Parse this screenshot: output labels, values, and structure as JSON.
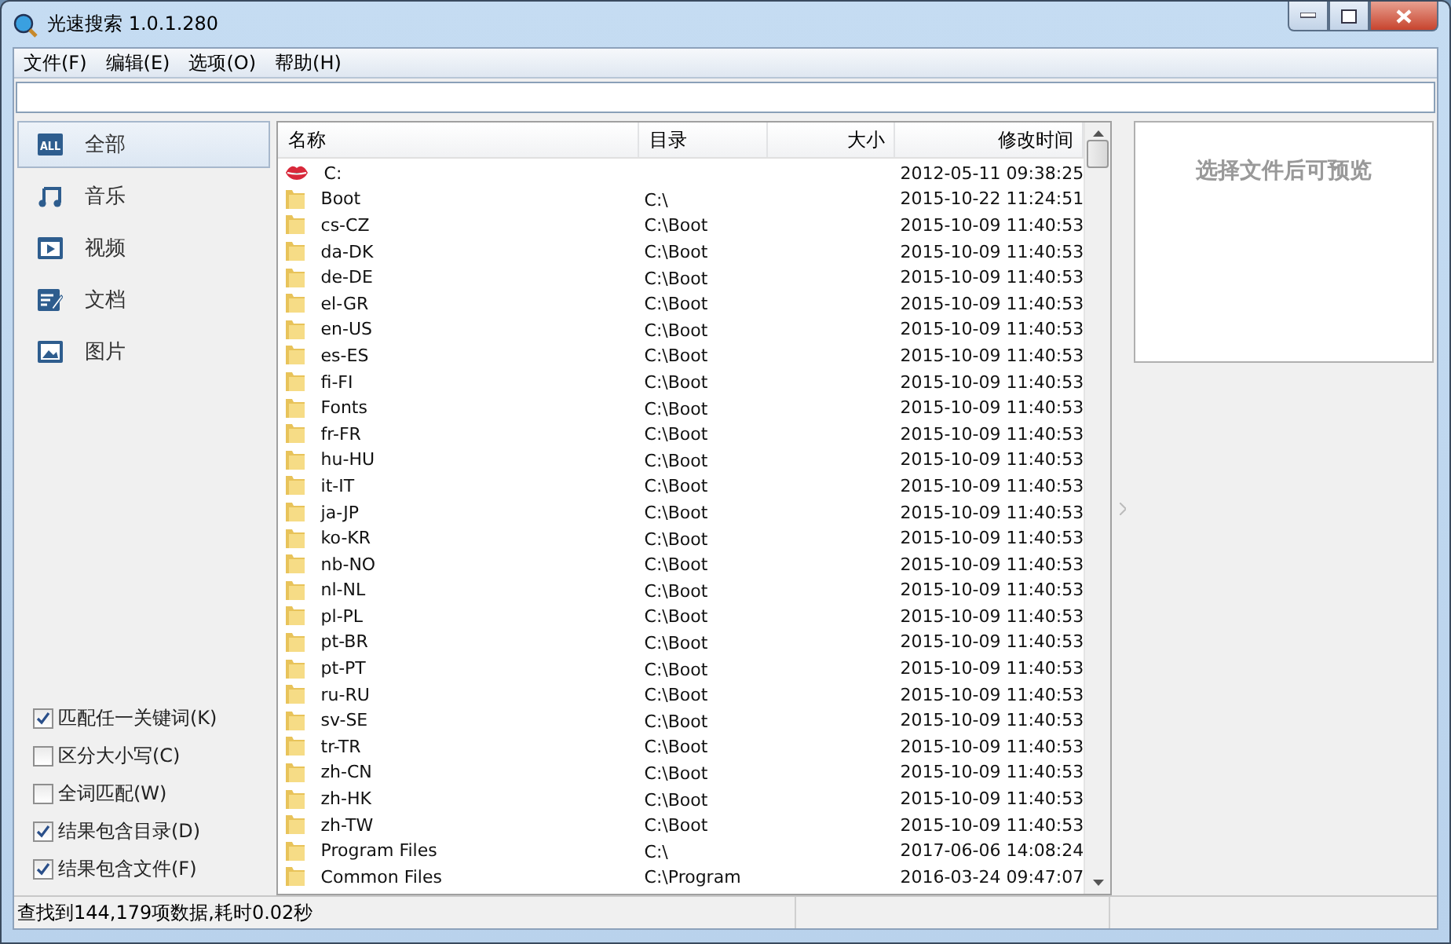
{
  "window": {
    "title": "光速搜索 1.0.1.280"
  },
  "menu": [
    "文件(F)",
    "编辑(E)",
    "选项(O)",
    "帮助(H)"
  ],
  "categories": [
    {
      "label": "全部",
      "kind": "all",
      "icon_text": "ALL",
      "selected": true
    },
    {
      "label": "音乐",
      "kind": "music",
      "selected": false
    },
    {
      "label": "视频",
      "kind": "video",
      "selected": false
    },
    {
      "label": "文档",
      "kind": "document",
      "selected": false
    },
    {
      "label": "图片",
      "kind": "image",
      "selected": false
    }
  ],
  "options": [
    {
      "label": "匹配任一关键词(K)",
      "checked": true
    },
    {
      "label": "区分大小写(C)",
      "checked": false
    },
    {
      "label": "全词匹配(W)",
      "checked": false
    },
    {
      "label": "结果包含目录(D)",
      "checked": true
    },
    {
      "label": "结果包含文件(F)",
      "checked": true
    }
  ],
  "table": {
    "columns": [
      "名称",
      "目录",
      "大小",
      "修改时间"
    ],
    "rows": [
      {
        "kind": "drive",
        "name": "C:",
        "modified": "2012-05-11 09:38:25"
      },
      {
        "kind": "folder",
        "name": "Boot",
        "dir": "C:\\",
        "modified": "2015-10-22 11:24:51"
      },
      {
        "kind": "folder",
        "name": "cs-CZ",
        "dir": "C:\\Boot",
        "modified": "2015-10-09 11:40:53"
      },
      {
        "kind": "folder",
        "name": "da-DK",
        "dir": "C:\\Boot",
        "modified": "2015-10-09 11:40:53"
      },
      {
        "kind": "folder",
        "name": "de-DE",
        "dir": "C:\\Boot",
        "modified": "2015-10-09 11:40:53"
      },
      {
        "kind": "folder",
        "name": "el-GR",
        "dir": "C:\\Boot",
        "modified": "2015-10-09 11:40:53"
      },
      {
        "kind": "folder",
        "name": "en-US",
        "dir": "C:\\Boot",
        "modified": "2015-10-09 11:40:53"
      },
      {
        "kind": "folder",
        "name": "es-ES",
        "dir": "C:\\Boot",
        "modified": "2015-10-09 11:40:53"
      },
      {
        "kind": "folder",
        "name": "fi-FI",
        "dir": "C:\\Boot",
        "modified": "2015-10-09 11:40:53"
      },
      {
        "kind": "folder",
        "name": "Fonts",
        "dir": "C:\\Boot",
        "modified": "2015-10-09 11:40:53"
      },
      {
        "kind": "folder",
        "name": "fr-FR",
        "dir": "C:\\Boot",
        "modified": "2015-10-09 11:40:53"
      },
      {
        "kind": "folder",
        "name": "hu-HU",
        "dir": "C:\\Boot",
        "modified": "2015-10-09 11:40:53"
      },
      {
        "kind": "folder",
        "name": "it-IT",
        "dir": "C:\\Boot",
        "modified": "2015-10-09 11:40:53"
      },
      {
        "kind": "folder",
        "name": "ja-JP",
        "dir": "C:\\Boot",
        "modified": "2015-10-09 11:40:53"
      },
      {
        "kind": "folder",
        "name": "ko-KR",
        "dir": "C:\\Boot",
        "modified": "2015-10-09 11:40:53"
      },
      {
        "kind": "folder",
        "name": "nb-NO",
        "dir": "C:\\Boot",
        "modified": "2015-10-09 11:40:53"
      },
      {
        "kind": "folder",
        "name": "nl-NL",
        "dir": "C:\\Boot",
        "modified": "2015-10-09 11:40:53"
      },
      {
        "kind": "folder",
        "name": "pl-PL",
        "dir": "C:\\Boot",
        "modified": "2015-10-09 11:40:53"
      },
      {
        "kind": "folder",
        "name": "pt-BR",
        "dir": "C:\\Boot",
        "modified": "2015-10-09 11:40:53"
      },
      {
        "kind": "folder",
        "name": "pt-PT",
        "dir": "C:\\Boot",
        "modified": "2015-10-09 11:40:53"
      },
      {
        "kind": "folder",
        "name": "ru-RU",
        "dir": "C:\\Boot",
        "modified": "2015-10-09 11:40:53"
      },
      {
        "kind": "folder",
        "name": "sv-SE",
        "dir": "C:\\Boot",
        "modified": "2015-10-09 11:40:53"
      },
      {
        "kind": "folder",
        "name": "tr-TR",
        "dir": "C:\\Boot",
        "modified": "2015-10-09 11:40:53"
      },
      {
        "kind": "folder",
        "name": "zh-CN",
        "dir": "C:\\Boot",
        "modified": "2015-10-09 11:40:53"
      },
      {
        "kind": "folder",
        "name": "zh-HK",
        "dir": "C:\\Boot",
        "modified": "2015-10-09 11:40:53"
      },
      {
        "kind": "folder",
        "name": "zh-TW",
        "dir": "C:\\Boot",
        "modified": "2015-10-09 11:40:53"
      },
      {
        "kind": "folder",
        "name": "Program Files",
        "dir": "C:\\",
        "modified": "2017-06-06 14:08:24"
      },
      {
        "kind": "folder",
        "name": "Common Files",
        "dir": "C:\\Program",
        "modified": "2016-03-24 09:47:07"
      }
    ]
  },
  "preview": {
    "message": "选择文件后可预览"
  },
  "status_bar": {
    "text": "查找到144,179项数据,耗时0.02秒"
  }
}
